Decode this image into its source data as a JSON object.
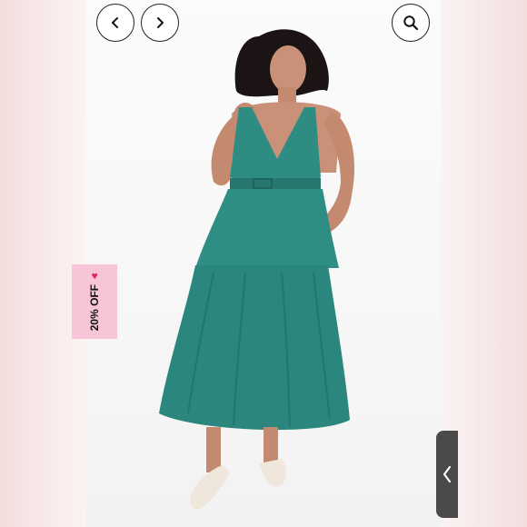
{
  "nav": {
    "prev_icon": "chevron-left-icon",
    "next_icon": "chevron-right-icon",
    "search_icon": "search-icon"
  },
  "promo": {
    "label": "20% OFF",
    "icon": "heart-icon"
  },
  "drawer": {
    "icon": "chevron-left-icon"
  },
  "colors": {
    "dress": "#2e8c82",
    "badge": "#f7c4d8",
    "tab": "#4a4a4a",
    "heart": "#e0245e"
  }
}
